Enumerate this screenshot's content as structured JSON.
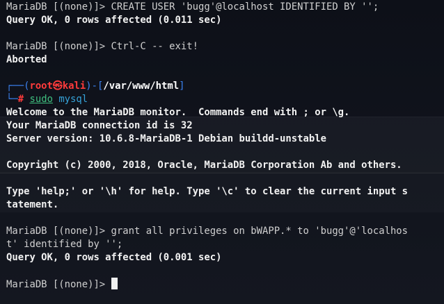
{
  "lines": {
    "l1": "MariaDB [(none)]> CREATE USER 'bugg'@localhost IDENTIFIED BY '';",
    "l2": "Query OK, 0 rows affected (0.011 sec)",
    "l3": "MariaDB [(none)]> Ctrl-C -- exit!",
    "l4": "Aborted",
    "prompt_user": "root",
    "prompt_symbol": "㉿",
    "prompt_host": "kali",
    "prompt_path": "/var/www/html",
    "cmd_sudo": "sudo",
    "cmd_mysql": "mysql",
    "l6": "Welcome to the MariaDB monitor.  Commands end with ; or \\g.",
    "l7": "Your MariaDB connection id is 32",
    "l8": "Server version: 10.6.8-MariaDB-1 Debian buildd-unstable",
    "l9": "Copyright (c) 2000, 2018, Oracle, MariaDB Corporation Ab and others.",
    "l10": "Type 'help;' or '\\h' for help. Type '\\c' to clear the current input s",
    "l11": "tatement.",
    "l12": "MariaDB [(none)]> grant all privileges on bWAPP.* to 'bugg'@'localhos",
    "l13": "t' identified by '';",
    "l14": "Query OK, 0 rows affected (0.001 sec)",
    "l15": "MariaDB [(none)]> "
  }
}
